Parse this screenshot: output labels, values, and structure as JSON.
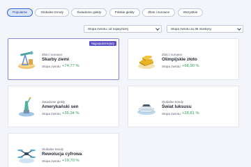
{
  "tabs": [
    "Popularne",
    "Globalne trendy",
    "Świadome giełdy",
    "Polskie giełdy",
    "Złoto i surowce",
    "Wszystkie"
  ],
  "sort_select": {
    "value": "Stopa zwrotu: od najwyższej"
  },
  "period_select": {
    "value": "Stopa zwrotu za 36 miesięcy"
  },
  "badge_text": "Najpopularniejszy",
  "return_label": "Stopa zwrotu",
  "cards": [
    {
      "category": "Złoto i surowce",
      "name": "Skarby ziemi",
      "return": "+74,77 %",
      "icon": "oil-pump-icon"
    },
    {
      "category": "Złoto i surowce",
      "name": "Olimpijskie złoto",
      "return": "+68,90 %",
      "icon": "gold-bars-icon"
    },
    {
      "category": "Świadome giełdy",
      "name": "Amerykański sen",
      "return": "+35,34 %",
      "icon": "statue-of-liberty-icon"
    },
    {
      "category": "Globalne trendy",
      "name": "Świat luksusu",
      "return": "+28,81 %",
      "icon": "yacht-icon"
    },
    {
      "category": "Globalne trendy",
      "name": "Rewolucja cyfrowa",
      "return": "+19,70 %",
      "icon": "drone-icon"
    }
  ],
  "colors": {
    "accent": "#2f66d4",
    "badge": "#5b4fc7",
    "positive": "#2e9a5b"
  }
}
